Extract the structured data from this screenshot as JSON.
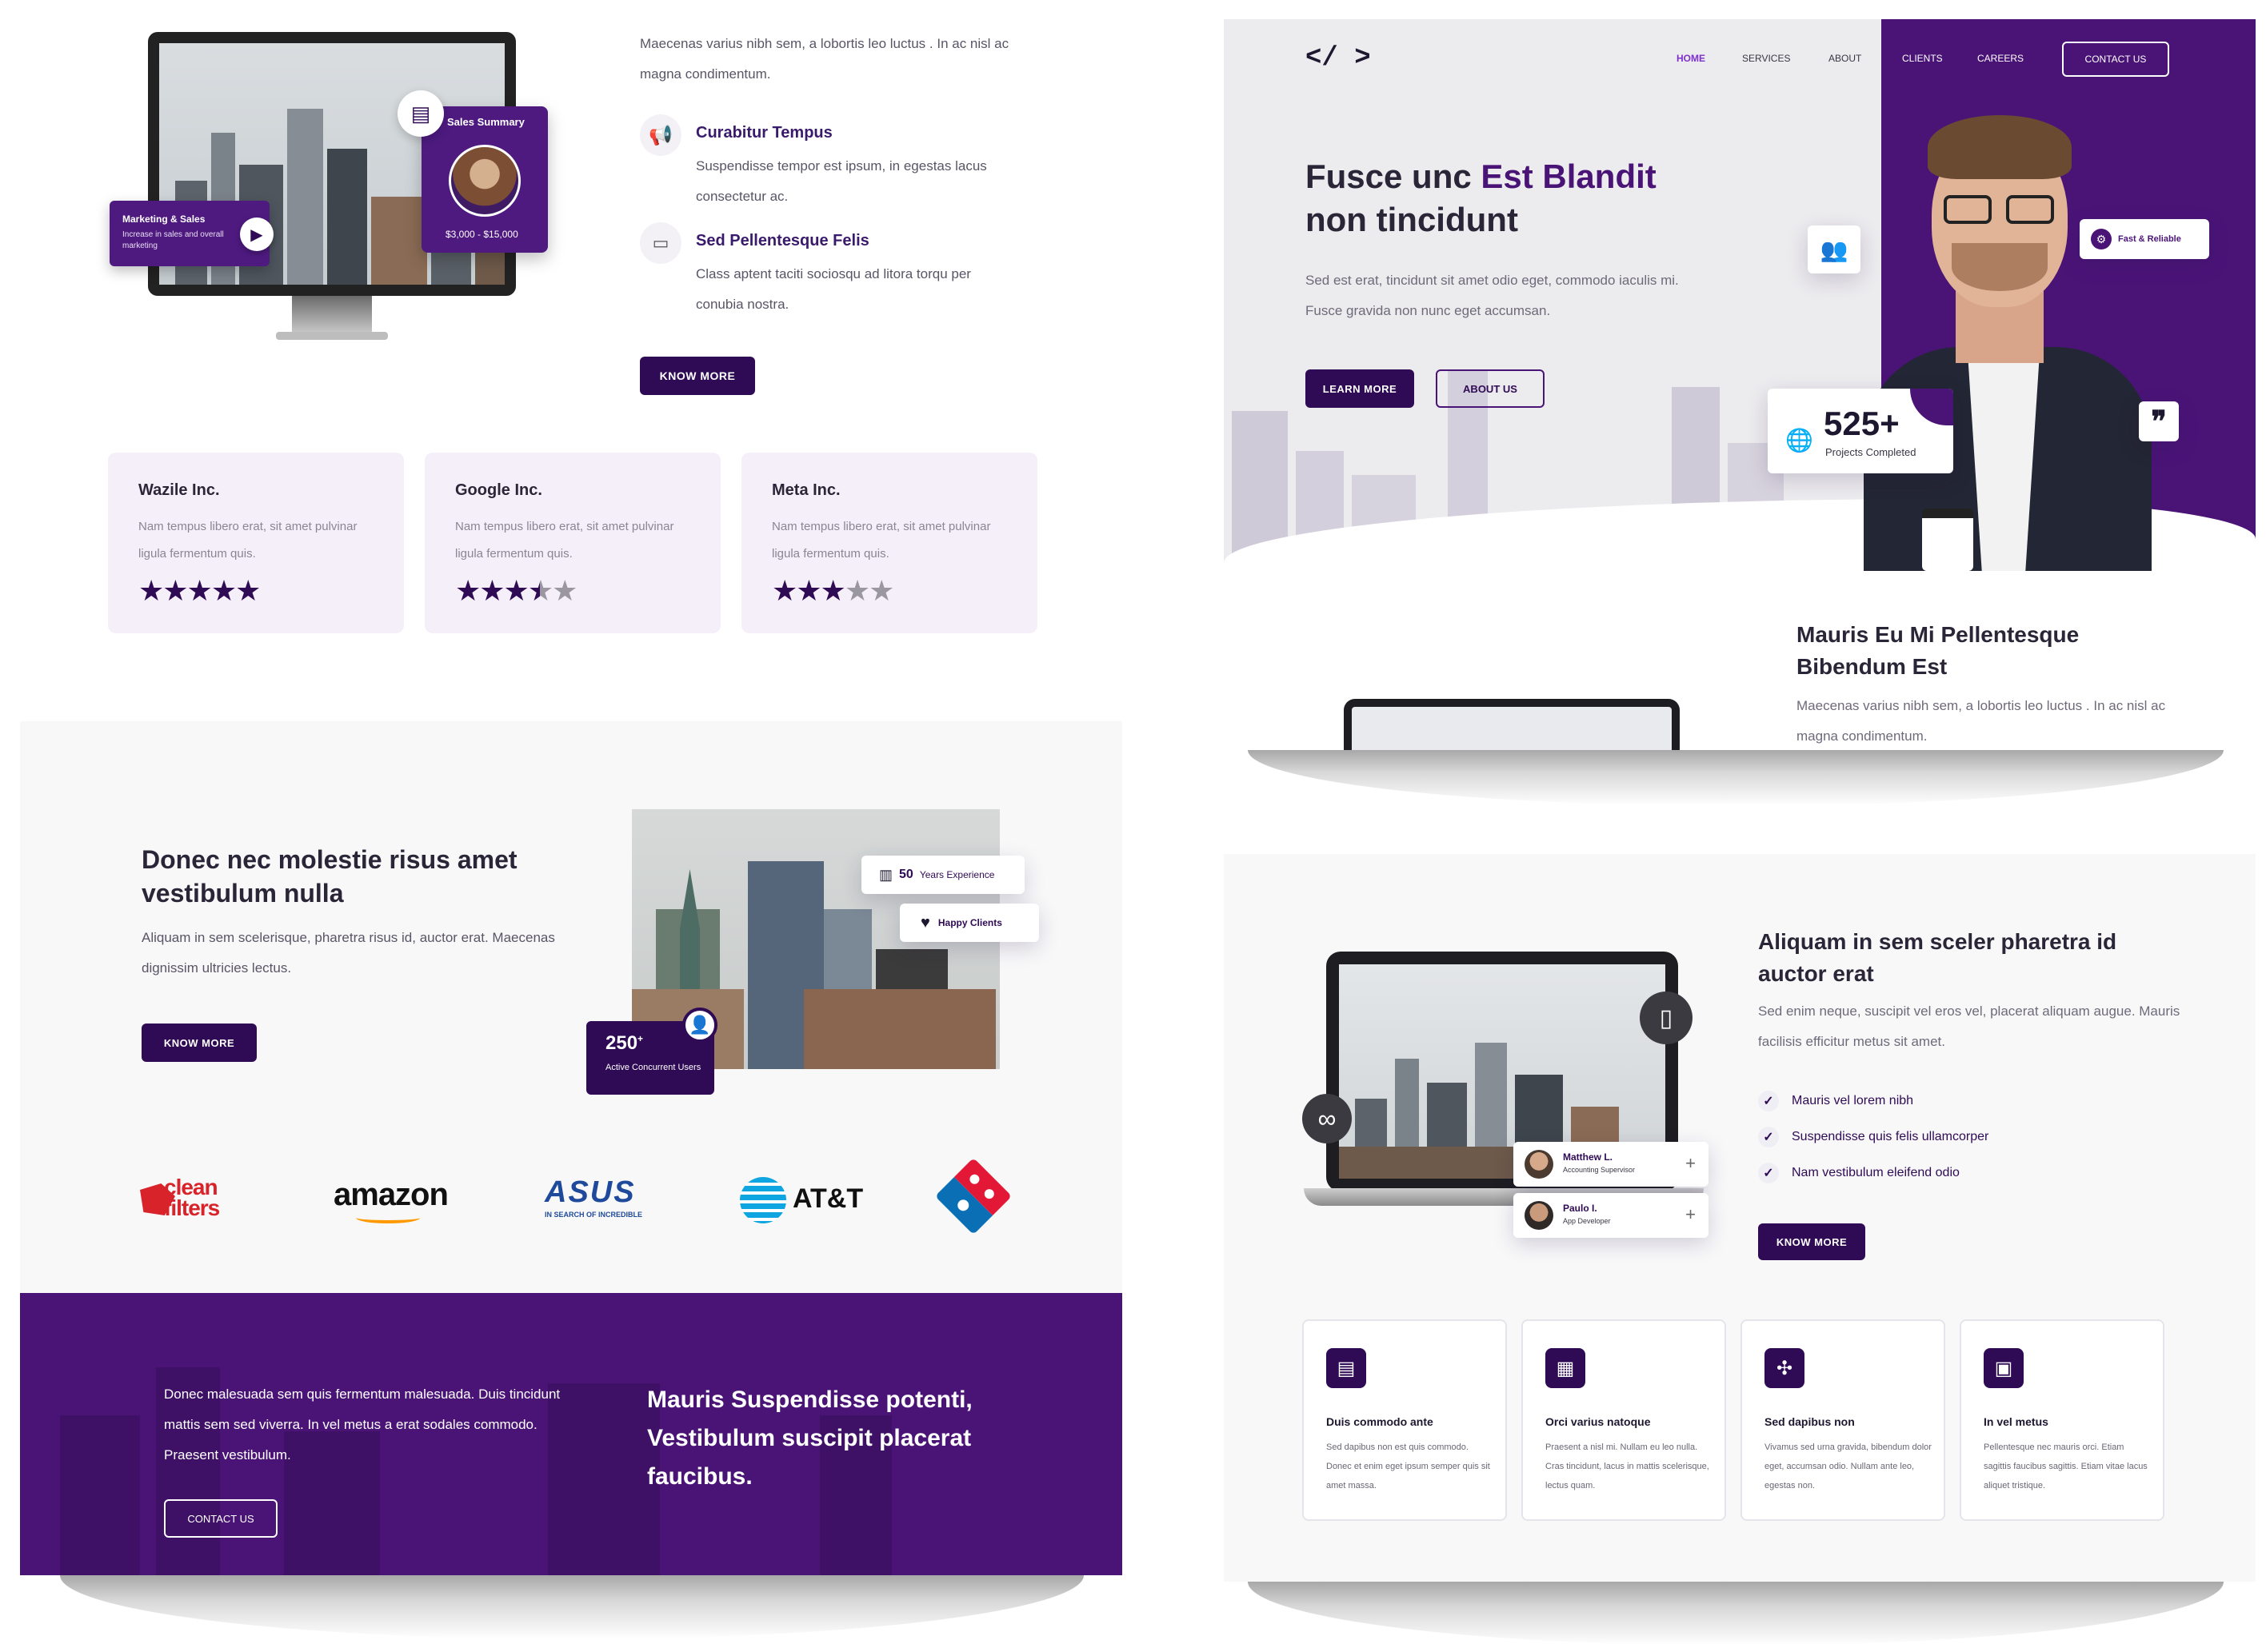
{
  "panel1": {
    "sales_summary_label": "Sales Summary",
    "sales_range": "$3,000 - $15,000",
    "marketing_title": "Marketing & Sales",
    "marketing_sub": "Increase in sales and overall marketing",
    "intro": "Maecenas varius nibh sem, a lobortis leo luctus . In ac nisl ac magna condimentum.",
    "features": [
      {
        "title": "Curabitur Tempus",
        "desc": "Suspendisse tempor est ipsum, in egestas lacus consectetur ac.",
        "icon": "megaphone-icon"
      },
      {
        "title": "Sed Pellentesque Felis",
        "desc": "Class aptent taciti sociosqu ad litora torqu per conubia nostra.",
        "icon": "browser-icon"
      }
    ],
    "button": "KNOW MORE",
    "reviews": [
      {
        "company": "Wazile Inc.",
        "text": "Nam tempus libero erat, sit amet pulvinar ligula fermentum quis.",
        "rating": 5
      },
      {
        "company": "Google Inc.",
        "text": "Nam tempus libero erat, sit amet pulvinar ligula fermentum quis.",
        "rating": 3.5
      },
      {
        "company": "Meta Inc.",
        "text": "Nam tempus libero erat, sit amet pulvinar ligula fermentum quis.",
        "rating": 3
      }
    ]
  },
  "panel2": {
    "logo": "</ >",
    "nav": [
      "HOME",
      "SERVICES",
      "ABOUT",
      "CLIENTS",
      "CAREERS"
    ],
    "contact_btn": "CONTACT US",
    "title_part1": "Fusce unc ",
    "title_highlight": "Est Blandit",
    "title_part2": "non tincidunt",
    "desc": "Sed est erat, tincidunt sit amet odio eget, commodo iaculis mi. Fusce gravida non nunc eget accumsan.",
    "btn_learn": "LEARN MORE",
    "btn_about": "ABOUT US",
    "fast_label": "Fast & Reliable",
    "stat_value": "525+",
    "stat_label": "Projects Completed",
    "sub_title": "Mauris Eu Mi Pellentesque Bibendum Est",
    "sub_desc": "Maecenas varius nibh sem, a lobortis leo luctus . In ac nisl ac magna condimentum."
  },
  "panel3": {
    "title": "Donec nec molestie risus amet vestibulum nulla",
    "desc": "Aliquam in sem scelerisque, pharetra risus id, auctor erat. Maecenas dignissim ultricies lectus.",
    "button": "KNOW MORE",
    "exp_value": "50",
    "exp_label": "Years Experience",
    "happy_label": "Happy Clients",
    "users_value": "250",
    "users_sup": "+",
    "users_label": "Active Concurrent Users",
    "logos": [
      "clean filters",
      "amazon",
      "ASUS",
      "IN SEARCH OF INCREDIBLE",
      "AT&T"
    ],
    "banner_text": "Donec malesuada sem quis fermentum malesuada. Duis tincidunt mattis sem sed viverra. In vel metus a erat sodales commodo. Praesent vestibulum.",
    "banner_btn": "CONTACT US",
    "banner_title": "Mauris Suspendisse potenti, Vestibulum suscipit placerat faucibus."
  },
  "panel4": {
    "title": "Aliquam in sem sceler pharetra id auctor erat",
    "desc": "Sed enim neque, suscipit vel eros vel, placerat aliquam augue. Mauris facilisis efficitur metus sit amet.",
    "checks": [
      "Mauris vel lorem nibh",
      "Suspendisse quis felis ullamcorper",
      "Nam vestibulum eleifend odio"
    ],
    "button": "KNOW MORE",
    "team": [
      {
        "name": "Matthew L.",
        "role": "Accounting Supervisor"
      },
      {
        "name": "Paulo I.",
        "role": "App Developer"
      }
    ],
    "cards": [
      {
        "title": "Duis commodo ante",
        "desc": "Sed dapibus non est quis commodo. Donec et enim eget ipsum semper quis sit amet massa.",
        "icon": "document-icon"
      },
      {
        "title": "Orci varius natoque",
        "desc": "Praesent a nisl mi. Nullam eu leo nulla. Cras tincidunt, lacus in mattis scelerisque, lectus quam.",
        "icon": "layout-icon"
      },
      {
        "title": "Sed dapibus non",
        "desc": "Vivamus sed urna gravida, bibendum dolor eget, accumsan odio. Nullam ante leo, egestas non.",
        "icon": "network-icon"
      },
      {
        "title": "In vel metus",
        "desc": "Pellentesque nec mauris orci. Etiam sagittis faucibus sagittis. Etiam vitae lacus aliquet tristique.",
        "icon": "clipboard-icon"
      }
    ]
  },
  "colors": {
    "primary": "#2f0a55",
    "accent": "#4e1a80",
    "lavender": "#f4eff9"
  }
}
